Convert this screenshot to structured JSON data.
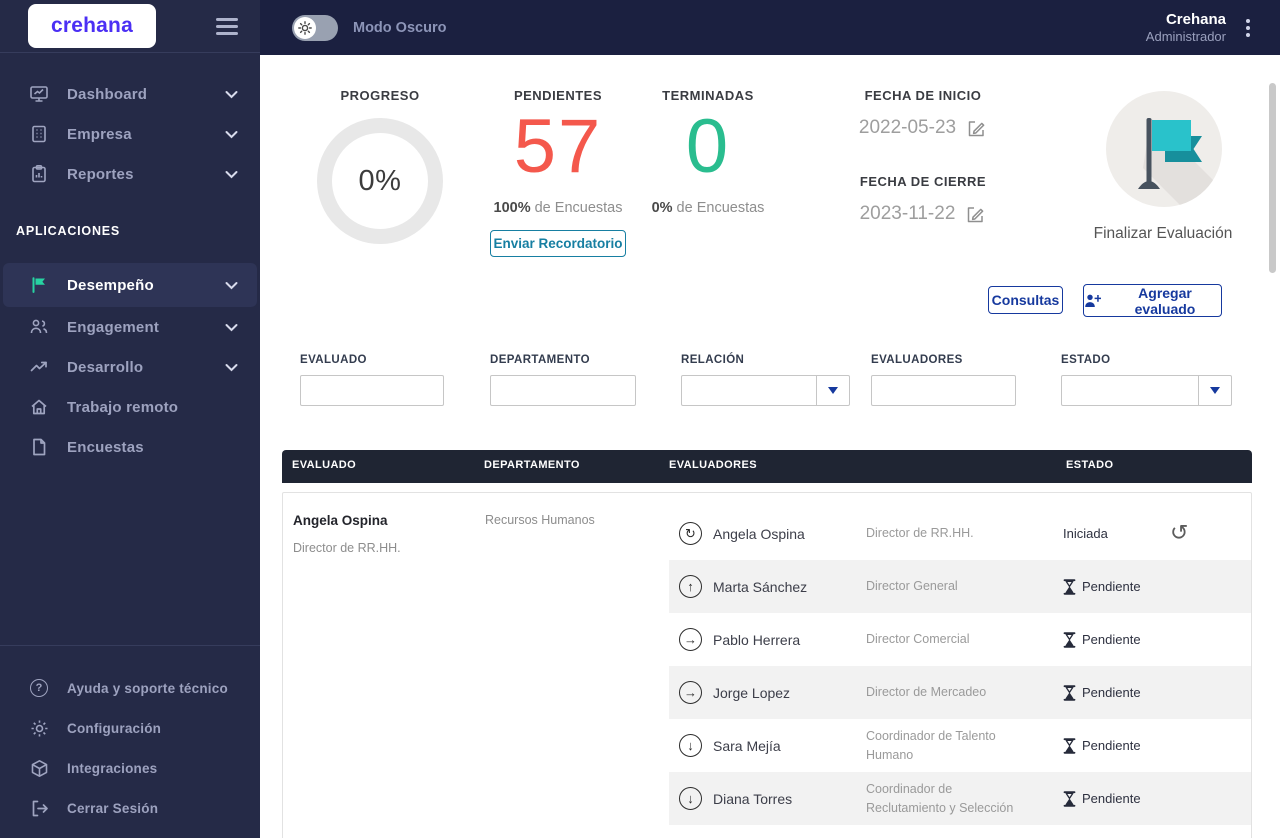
{
  "brand": {
    "logo_text": "crehana",
    "logo_color": "#4b2ff4"
  },
  "topbar": {
    "dark_mode_label": "Modo Oscuro",
    "account_name": "Crehana",
    "account_role": "Administrador"
  },
  "sidebar": {
    "main_items": [
      {
        "label": "Dashboard"
      },
      {
        "label": "Empresa"
      },
      {
        "label": "Reportes"
      }
    ],
    "section_label": "APLICACIONES",
    "app_items": [
      {
        "label": "Desempeño"
      },
      {
        "label": "Engagement"
      },
      {
        "label": "Desarrollo"
      },
      {
        "label": "Trabajo remoto"
      },
      {
        "label": "Encuestas"
      }
    ],
    "footer_items": [
      {
        "label": "Ayuda y soporte técnico"
      },
      {
        "label": "Configuración"
      },
      {
        "label": "Integraciones"
      },
      {
        "label": "Cerrar Sesión"
      }
    ]
  },
  "stats": {
    "progreso": {
      "label": "PROGRESO",
      "value": "0%"
    },
    "pendientes": {
      "label": "PENDIENTES",
      "count": "57",
      "sub_bold": "100%",
      "sub_rest": " de Encuestas",
      "button_label": "Enviar Recordatorio"
    },
    "terminadas": {
      "label": "TERMINADAS",
      "count": "0",
      "sub_bold": "0%",
      "sub_rest": " de Encuestas"
    },
    "fecha_inicio": {
      "label": "FECHA DE INICIO",
      "value": "2022-05-23"
    },
    "fecha_cierre": {
      "label": "FECHA DE CIERRE",
      "value": "2023-11-22"
    },
    "finalizar_label": "Finalizar Evaluación"
  },
  "actions": {
    "consultas_label": "Consultas",
    "agregar_label": "Agregar evaluado"
  },
  "filters": [
    {
      "label": "EVALUADO",
      "type": "text",
      "value": ""
    },
    {
      "label": "DEPARTAMENTO",
      "type": "text",
      "value": ""
    },
    {
      "label": "RELACIÓN",
      "type": "select",
      "value": ""
    },
    {
      "label": "EVALUADORES",
      "type": "text",
      "value": ""
    },
    {
      "label": "ESTADO",
      "type": "select",
      "value": ""
    }
  ],
  "table": {
    "headers": [
      "EVALUADO",
      "DEPARTAMENTO",
      "EVALUADORES",
      "ESTADO"
    ],
    "row": {
      "evaluado_name": "Angela Ospina",
      "evaluado_role": "Director de RR.HH.",
      "departamento": "Recursos Humanos",
      "evaluadores": [
        {
          "name": "Angela Ospina",
          "relation": "self",
          "role": "Director de RR.HH.",
          "status": "Iniciada",
          "status_icon": "none",
          "has_undo": true
        },
        {
          "name": "Marta Sánchez",
          "relation": "up",
          "role": "Director General",
          "status": "Pendiente",
          "status_icon": "hourglass",
          "has_undo": false
        },
        {
          "name": "Pablo Herrera",
          "relation": "right",
          "role": "Director Comercial",
          "status": "Pendiente",
          "status_icon": "hourglass",
          "has_undo": false
        },
        {
          "name": "Jorge Lopez",
          "relation": "right",
          "role": "Director de Mercadeo",
          "status": "Pendiente",
          "status_icon": "hourglass",
          "has_undo": false
        },
        {
          "name": "Sara Mejía",
          "relation": "down",
          "role": "Coordinador de Talento Humano",
          "status": "Pendiente",
          "status_icon": "hourglass",
          "has_undo": false
        },
        {
          "name": "Diana Torres",
          "relation": "down",
          "role": "Coordinador de Reclutamiento y Selección",
          "status": "Pendiente",
          "status_icon": "hourglass",
          "has_undo": false
        }
      ]
    }
  },
  "icon_glyphs": {
    "self": "↻",
    "up": "↑",
    "right": "→",
    "down": "↓",
    "undo": "↺"
  },
  "colors": {
    "sidebar_bg": "#252a47",
    "topbar_bg": "#1b2040",
    "active_item_bg": "#2e3456",
    "active_icon_teal": "#27d3a2",
    "pendientes_red": "#f4584c",
    "terminadas_green": "#2abd8f",
    "reminder_teal": "#177fa2",
    "primary_blue": "#16399e",
    "table_header_bg": "#1f2533",
    "row_alt_gray": "#f2f2f2"
  }
}
